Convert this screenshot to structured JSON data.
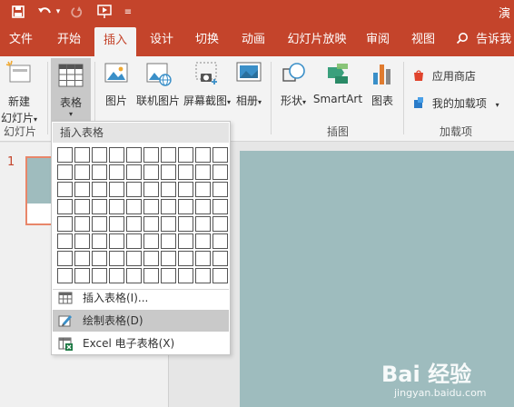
{
  "titlebar": {
    "title_fragment": "演",
    "save_icon": "save-icon",
    "undo_icon": "undo-icon",
    "redo_icon": "redo-icon",
    "present_icon": "present-from-start-icon",
    "customize_icon": "customize-quick-access-icon"
  },
  "tabs": [
    {
      "label": "文件"
    },
    {
      "label": "开始"
    },
    {
      "label": "插入",
      "active": true
    },
    {
      "label": "设计"
    },
    {
      "label": "切换"
    },
    {
      "label": "动画"
    },
    {
      "label": "幻灯片放映"
    },
    {
      "label": "审阅"
    },
    {
      "label": "视图"
    },
    {
      "label": "告诉我"
    }
  ],
  "ribbon": {
    "new_slide": {
      "line1": "新建",
      "line2": "幻灯片"
    },
    "slides_group": "幻灯片",
    "table": "表格",
    "picture": "图片",
    "online_picture": "联机图片",
    "screenshot": "屏幕截图",
    "album": "相册",
    "images_group": "插图",
    "shapes": "形状",
    "smartart": "SmartArt",
    "chart": "图表",
    "store": "应用商店",
    "my_addins": "我的加载项",
    "addins_group": "加载项"
  },
  "thumbnails": [
    {
      "number": "1"
    }
  ],
  "dropdown": {
    "header": "插入表格",
    "grid_columns": 10,
    "grid_rows": 8,
    "items": [
      {
        "label": "插入表格(I)...",
        "icon": "insert-table-icon"
      },
      {
        "label": "绘制表格(D)",
        "icon": "draw-table-icon",
        "highlighted": true
      },
      {
        "label": "Excel 电子表格(X)",
        "icon": "excel-spreadsheet-icon"
      }
    ]
  },
  "watermark": {
    "logo": "Bai 经验",
    "url": "jingyan.baidu.com"
  },
  "colors": {
    "accent": "#c4442b",
    "slide": "#9ebcbe",
    "ribbon": "#f3f3f3"
  }
}
